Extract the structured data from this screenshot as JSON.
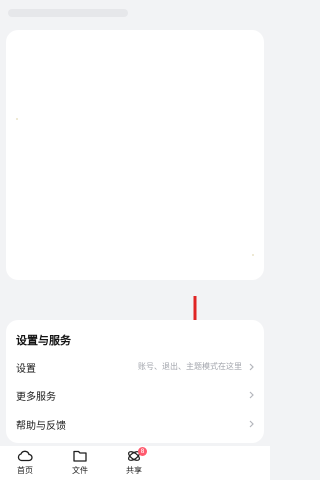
{
  "settings_section": {
    "title": "设置与服务",
    "rows": [
      {
        "label": "设置",
        "hint": "账号、退出、主题模式在这里"
      },
      {
        "label": "更多服务"
      },
      {
        "label": "帮助与反馈"
      }
    ]
  },
  "bottom_nav": {
    "items": [
      {
        "label": "首页",
        "icon": "cloud-icon"
      },
      {
        "label": "文件",
        "icon": "folder-icon"
      },
      {
        "label": "共享",
        "icon": "share-icon",
        "badge": "8"
      }
    ]
  },
  "colors": {
    "annotation_arrow": "#e02424",
    "badge": "#ff5a6e",
    "background": "#f2f3f5"
  }
}
